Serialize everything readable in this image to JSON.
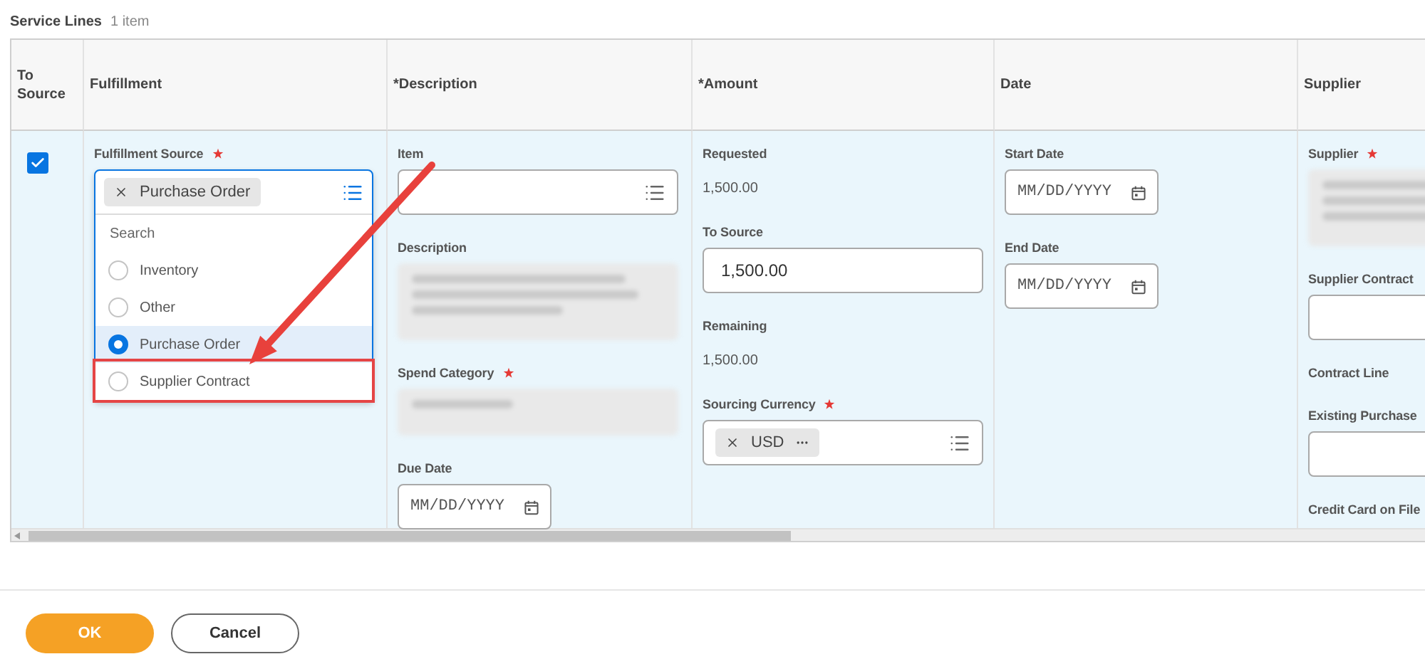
{
  "section": {
    "title": "Service Lines",
    "count": "1 item"
  },
  "table": {
    "columns": [
      "To Source",
      "Fulfillment",
      "*Description",
      "*Amount",
      "Date",
      "Supplier"
    ],
    "row": {
      "to_source_checked": true,
      "cells": [
        {
          "fields": [
            {
              "kind": "dropdown",
              "label": "Fulfillment Source",
              "required": true,
              "value": "Purchase Order",
              "search_placeholder": "Search",
              "options": [
                {
                  "label": "Inventory",
                  "selected": false,
                  "annotated": false
                },
                {
                  "label": "Other",
                  "selected": false,
                  "annotated": false
                },
                {
                  "label": "Purchase Order",
                  "selected": true,
                  "annotated": false
                },
                {
                  "label": "Supplier Contract",
                  "selected": false,
                  "annotated": true
                }
              ]
            }
          ]
        },
        {
          "fields": [
            {
              "kind": "prompt",
              "label": "Item",
              "required": false
            },
            {
              "kind": "blurred-textarea",
              "label": "Description",
              "required": false
            },
            {
              "kind": "blurred-prompt",
              "label": "Spend Category",
              "required": true
            },
            {
              "kind": "date",
              "label": "Due Date",
              "required": false,
              "placeholder": "MM/DD/YYYY"
            }
          ]
        },
        {
          "fields": [
            {
              "kind": "readonly",
              "label": "Requested",
              "required": false,
              "value": "1,500.00"
            },
            {
              "kind": "input",
              "label": "To Source",
              "required": false,
              "value": "1,500.00"
            },
            {
              "kind": "readonly",
              "label": "Remaining",
              "required": false,
              "value": "1,500.00"
            },
            {
              "kind": "prompt",
              "label": "Sourcing Currency",
              "required": true,
              "chip": "USD"
            }
          ]
        },
        {
          "fields": [
            {
              "kind": "date",
              "label": "Start Date",
              "required": false,
              "placeholder": "MM/DD/YYYY"
            },
            {
              "kind": "date",
              "label": "End Date",
              "required": false,
              "placeholder": "MM/DD/YYYY"
            }
          ]
        },
        {
          "fields": [
            {
              "kind": "blurred-textarea",
              "label": "Supplier",
              "required": true
            },
            {
              "kind": "input",
              "label": "Supplier Contract",
              "required": false
            },
            {
              "kind": "label",
              "label": "Contract Line",
              "required": false
            },
            {
              "kind": "input",
              "label": "Existing Purchase",
              "required": false
            },
            {
              "kind": "label",
              "label": "Credit Card on File",
              "required": false
            }
          ]
        }
      ]
    }
  },
  "buttons": [
    {
      "label": "OK",
      "kind": "primary"
    },
    {
      "label": "Cancel",
      "kind": "secondary"
    }
  ]
}
